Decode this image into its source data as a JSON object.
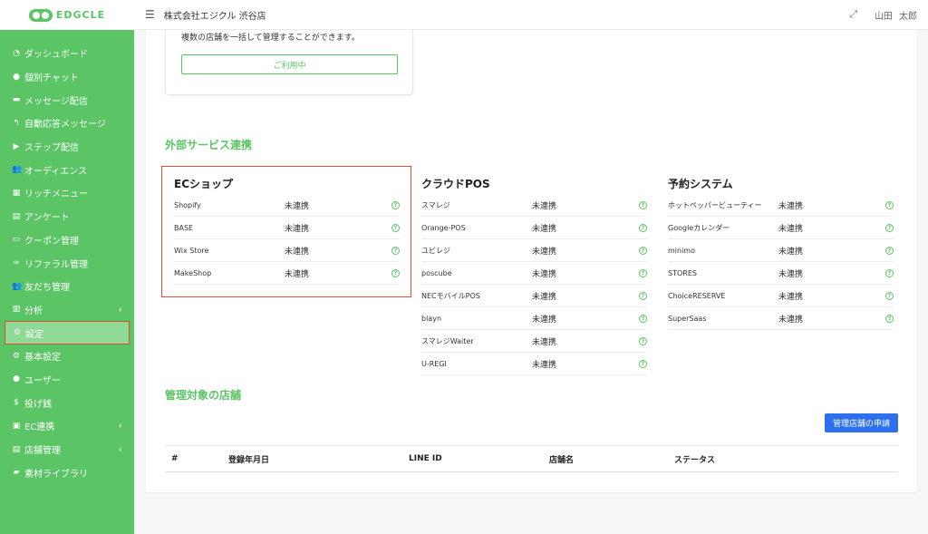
{
  "brand": {
    "logo_text": "EDGCLE"
  },
  "topbar": {
    "store_name": "株式会社エジクル 渋谷店",
    "user_name": "山田 太郎"
  },
  "sidebar": {
    "items": [
      {
        "icon": "dashboard-icon",
        "glyph": "◔",
        "label": "ダッシュボード"
      },
      {
        "icon": "chat-bubble-icon",
        "glyph": "●",
        "label": "個別チャット"
      },
      {
        "icon": "message-icon",
        "glyph": "▬",
        "label": "メッセージ配信"
      },
      {
        "icon": "reply-icon",
        "glyph": "↰",
        "label": "自動応答メッセージ"
      },
      {
        "icon": "play-circle-icon",
        "glyph": "▶",
        "label": "ステップ配信"
      },
      {
        "icon": "users-icon",
        "glyph": "👥",
        "label": "オーディエンス"
      },
      {
        "icon": "grid-icon",
        "glyph": "▦",
        "label": "リッチメニュー"
      },
      {
        "icon": "survey-icon",
        "glyph": "▤",
        "label": "アンケート"
      },
      {
        "icon": "ticket-icon",
        "glyph": "▭",
        "label": "クーポン管理"
      },
      {
        "icon": "link-icon",
        "glyph": "∞",
        "label": "リファラル管理"
      },
      {
        "icon": "friends-icon",
        "glyph": "👥",
        "label": "友だち管理"
      },
      {
        "icon": "chart-icon",
        "glyph": "▥",
        "label": "分析",
        "chevron": "‹"
      },
      {
        "icon": "gear-icon",
        "glyph": "⚙",
        "label": "設定",
        "active": true
      },
      {
        "icon": "gear-icon",
        "glyph": "⚙",
        "label": "基本設定"
      },
      {
        "icon": "user-icon",
        "glyph": "●",
        "label": "ユーザー"
      },
      {
        "icon": "dollar-icon",
        "glyph": "$",
        "label": "投げ銭"
      },
      {
        "icon": "bag-icon",
        "glyph": "▣",
        "label": "EC連携",
        "chevron": "‹"
      },
      {
        "icon": "store-icon",
        "glyph": "▤",
        "label": "店舗管理",
        "chevron": "‹"
      },
      {
        "icon": "folder-icon",
        "glyph": "▰",
        "label": "素材ライブラリ"
      }
    ]
  },
  "top_card": {
    "description": "複数の店舗を一括して管理することができます。",
    "button_label": "ご利用中"
  },
  "external_services": {
    "title": "外部サービス連携",
    "columns": [
      {
        "heading": "ECショップ",
        "rows": [
          {
            "name": "Shopify",
            "status": "未連携"
          },
          {
            "name": "BASE",
            "status": "未連携"
          },
          {
            "name": "Wix Store",
            "status": "未連携"
          },
          {
            "name": "MakeShop",
            "status": "未連携"
          }
        ]
      },
      {
        "heading": "クラウドPOS",
        "rows": [
          {
            "name": "スマレジ",
            "status": "未連携"
          },
          {
            "name": "Orange-POS",
            "status": "未連携"
          },
          {
            "name": "ユビレジ",
            "status": "未連携"
          },
          {
            "name": "poscube",
            "status": "未連携"
          },
          {
            "name": "NECモバイルPOS",
            "status": "未連携"
          },
          {
            "name": "blayn",
            "status": "未連携"
          },
          {
            "name": "スマレジWaiter",
            "status": "未連携"
          },
          {
            "name": "U-REGI",
            "status": "未連携"
          }
        ]
      },
      {
        "heading": "予約システム",
        "rows": [
          {
            "name": "ホットペッパービューティー",
            "status": "未連携"
          },
          {
            "name": "Googleカレンダー",
            "status": "未連携"
          },
          {
            "name": "minimo",
            "status": "未連携"
          },
          {
            "name": "STORES",
            "status": "未連携"
          },
          {
            "name": "ChoiceRESERVE",
            "status": "未連携"
          },
          {
            "name": "SuperSaas",
            "status": "未連携"
          }
        ]
      }
    ]
  },
  "managed_stores": {
    "title": "管理対象の店舗",
    "apply_button": "管理店舗の申請",
    "columns": [
      "#",
      "登録年月日",
      "LINE ID",
      "店舗名",
      "ステータス"
    ]
  },
  "colors": {
    "accent_green": "#5bc566",
    "primary_blue": "#2e6ff0",
    "highlight_red": "#e34a35"
  }
}
